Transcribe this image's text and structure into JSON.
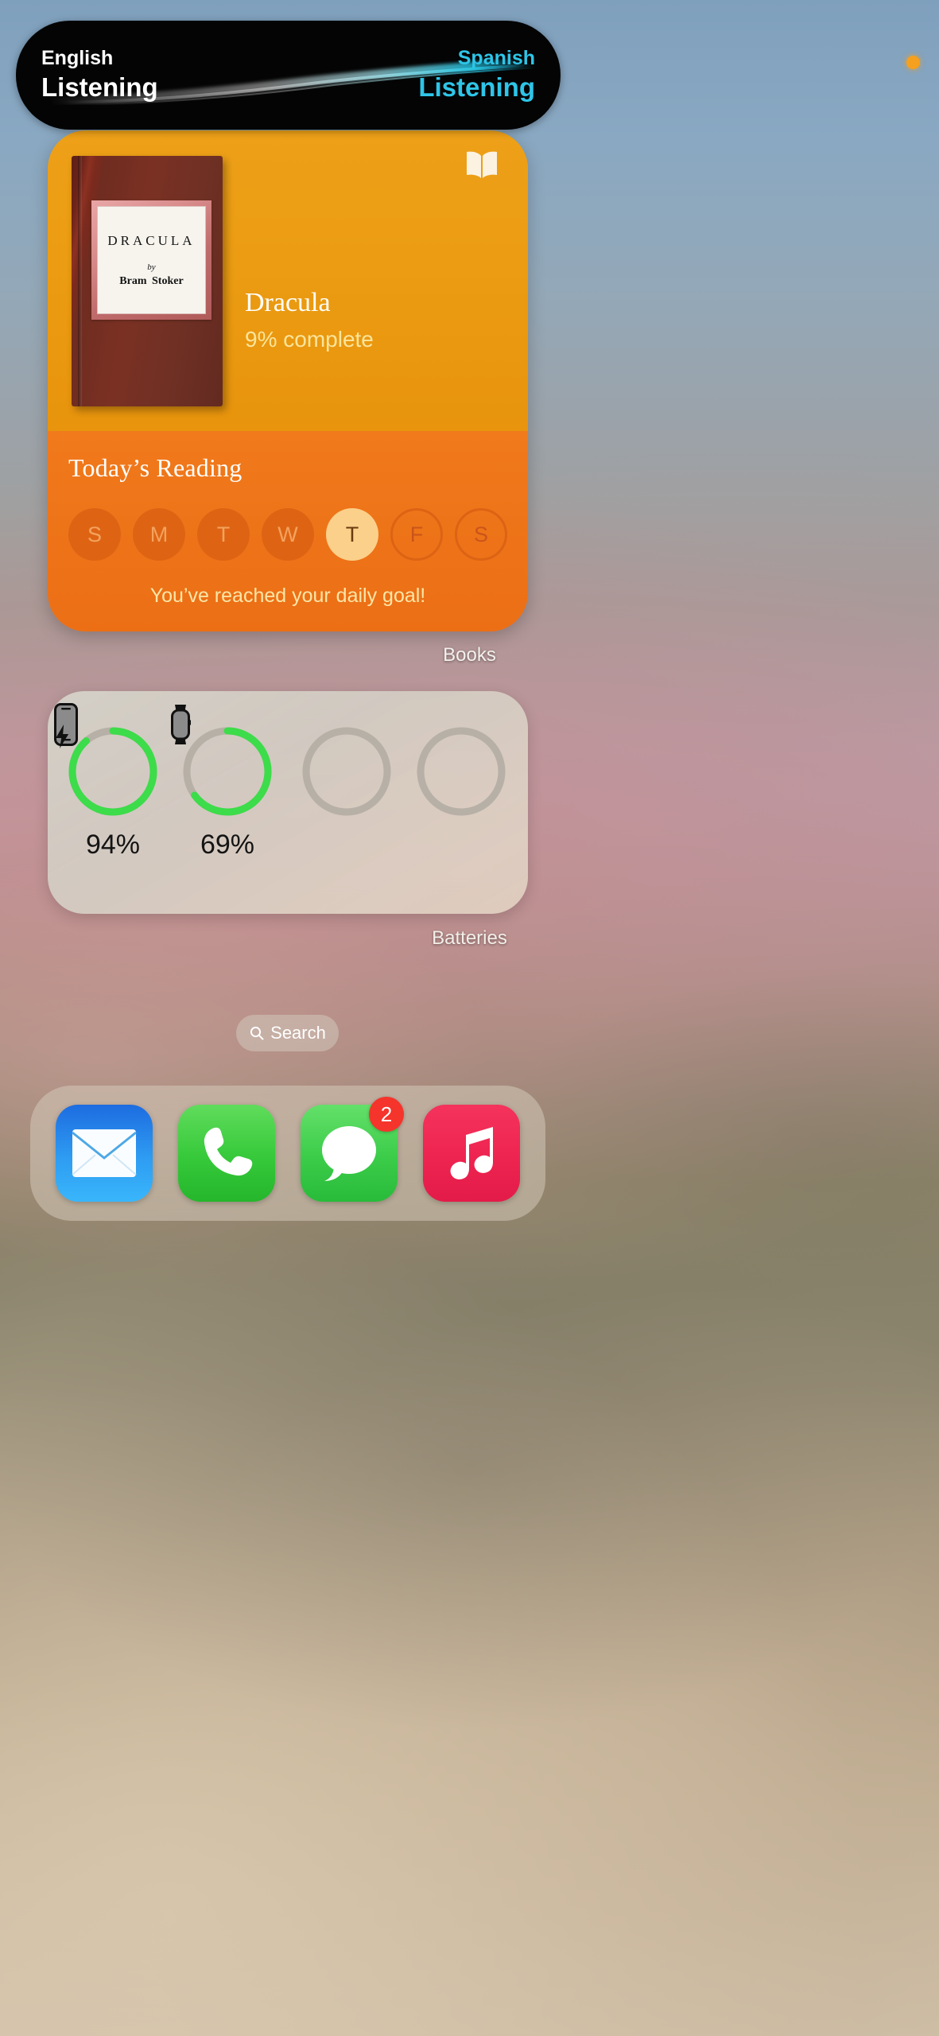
{
  "wallpaper": {
    "description": "blurred-gradient-wallpaper"
  },
  "status": {
    "privacy_indicator": "microphone-active-dot",
    "privacy_color": "#f5a01e"
  },
  "dynamic_island": {
    "name": "live-translation-activity",
    "left": {
      "language": "English",
      "state": "Listening"
    },
    "right": {
      "language": "Spanish",
      "state": "Listening"
    },
    "right_color": "#2ec5e8",
    "waveform": "audio-waveform"
  },
  "books_widget": {
    "app_label": "Books",
    "app_icon": "open-book-icon",
    "accent_top": "#e8960f",
    "accent_bottom": "#ee7318",
    "book": {
      "cover_title": "DRACULA",
      "cover_by": "by",
      "cover_author": "Bram  Stoker",
      "title": "Dracula",
      "progress": "9% complete",
      "progress_color": "#fbe59b"
    },
    "reading": {
      "heading": "Today’s Reading",
      "days": [
        {
          "letter": "S",
          "state": "filled"
        },
        {
          "letter": "M",
          "state": "filled"
        },
        {
          "letter": "T",
          "state": "filled"
        },
        {
          "letter": "W",
          "state": "filled"
        },
        {
          "letter": "T",
          "state": "today"
        },
        {
          "letter": "F",
          "state": "ring"
        },
        {
          "letter": "S",
          "state": "ring"
        }
      ],
      "goal_message": "You’ve reached your daily goal!"
    }
  },
  "batteries_widget": {
    "app_label": "Batteries",
    "ring_full_color": "#3ddc4a",
    "ring_empty_color": "#b7b0a6",
    "items": [
      {
        "device": "iphone-icon",
        "percent": "94%",
        "value": 94,
        "charging": true
      },
      {
        "device": "apple-watch-icon",
        "percent": "69%",
        "value": 69,
        "charging": false
      },
      {
        "device": "empty-slot",
        "percent": "",
        "value": 0,
        "charging": false
      },
      {
        "device": "empty-slot",
        "percent": "",
        "value": 0,
        "charging": false
      }
    ]
  },
  "search": {
    "label": "Search",
    "icon": "search-icon"
  },
  "dock": {
    "apps": [
      {
        "name": "Mail",
        "icon": "mail-icon",
        "badge": ""
      },
      {
        "name": "Phone",
        "icon": "phone-icon",
        "badge": ""
      },
      {
        "name": "Messages",
        "icon": "messages-icon",
        "badge": "2"
      },
      {
        "name": "Music",
        "icon": "music-icon",
        "badge": ""
      }
    ]
  }
}
